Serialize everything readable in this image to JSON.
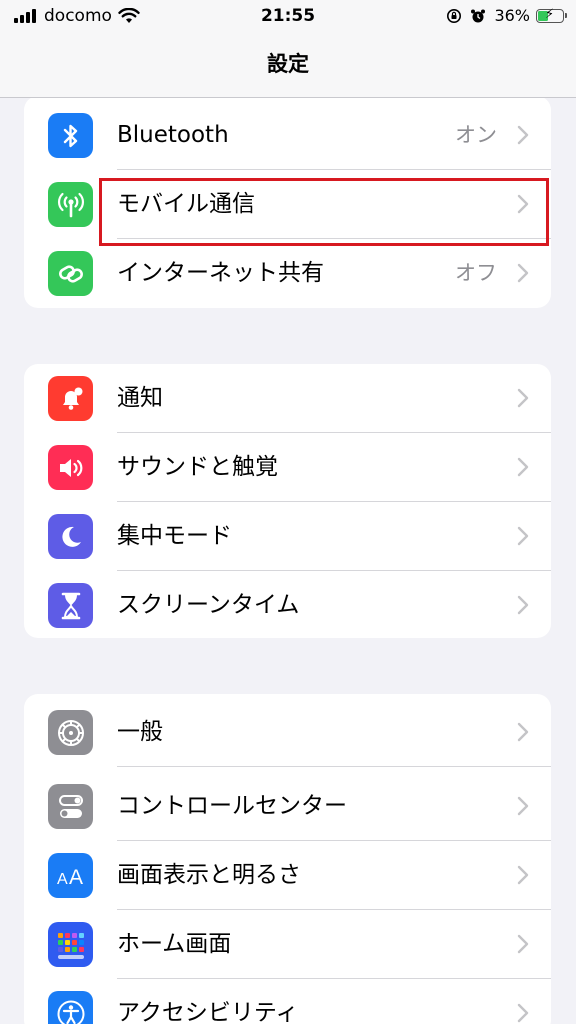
{
  "statusbar": {
    "carrier": "docomo",
    "time": "21:55",
    "battery_percent": "36%",
    "icons": [
      "signal-icon",
      "wifi-icon",
      "orientation-lock-icon",
      "alarm-icon",
      "battery-charging-icon"
    ]
  },
  "nav": {
    "title": "設定"
  },
  "colors": {
    "bluetooth": "#1a7cf5",
    "mobile": "#34c759",
    "hotspot": "#34c759",
    "notifications": "#ff3b30",
    "sounds": "#ff2d55",
    "focus": "#5e5ce6",
    "screentime": "#5e5ce6",
    "general": "#8e8e93",
    "control": "#8e8e93",
    "display": "#1a7cf5",
    "home": "#2f5bf0",
    "accessibility": "#1a7cf5",
    "highlight": "#d71920"
  },
  "groups": [
    {
      "items": [
        {
          "label": "Bluetooth",
          "value": "オン",
          "icon": "bluetooth-icon"
        },
        {
          "label": "モバイル通信",
          "value": "",
          "icon": "antenna-icon"
        },
        {
          "label": "インターネット共有",
          "value": "オフ",
          "icon": "hotspot-link-icon"
        }
      ]
    },
    {
      "items": [
        {
          "label": "通知",
          "value": "",
          "icon": "notification-bell-icon"
        },
        {
          "label": "サウンドと触覚",
          "value": "",
          "icon": "speaker-icon"
        },
        {
          "label": "集中モード",
          "value": "",
          "icon": "moon-icon"
        },
        {
          "label": "スクリーンタイム",
          "value": "",
          "icon": "hourglass-icon"
        }
      ]
    },
    {
      "items": [
        {
          "label": "一般",
          "value": "",
          "icon": "gear-icon"
        },
        {
          "label": "コントロールセンター",
          "value": "",
          "icon": "toggles-icon"
        },
        {
          "label": "画面表示と明るさ",
          "value": "",
          "icon": "text-size-icon"
        },
        {
          "label": "ホーム画面",
          "value": "",
          "icon": "home-grid-icon"
        },
        {
          "label": "アクセシビリティ",
          "value": "",
          "icon": "accessibility-icon"
        }
      ]
    }
  ]
}
